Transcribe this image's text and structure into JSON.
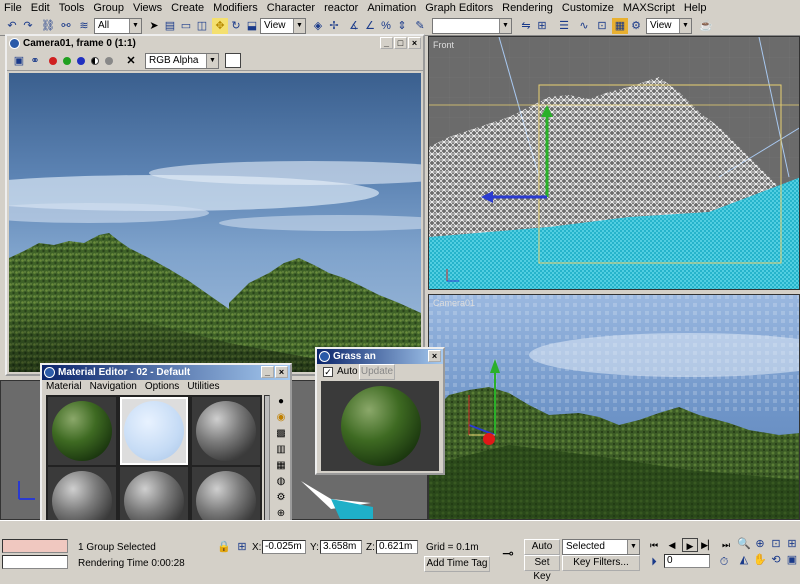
{
  "menu": [
    "File",
    "Edit",
    "Tools",
    "Group",
    "Views",
    "Create",
    "Modifiers",
    "Character",
    "reactor",
    "Animation",
    "Graph Editors",
    "Rendering",
    "Customize",
    "MAXScript",
    "Help"
  ],
  "toolbar": {
    "selection_filter": "All",
    "ref_coord_1": "View",
    "ref_coord_2": "View"
  },
  "render_window": {
    "title": "Camera01, frame 0 (1:1)",
    "channel": "RGB Alpha"
  },
  "front_viewport": {
    "label": "Front"
  },
  "persp_viewport": {
    "label": "Camera01"
  },
  "material_editor": {
    "title": "Material Editor - 02 - Default",
    "menu": [
      "Material",
      "Navigation",
      "Options",
      "Utilities"
    ]
  },
  "grass_window": {
    "title": "Grass an",
    "auto_label": "Auto",
    "update_label": "Update"
  },
  "status": {
    "selection": "1 Group Selected",
    "render_time": "Rendering Time  0:00:28",
    "x_label": "X:",
    "x_value": "-0.025m",
    "y_label": "Y:",
    "y_value": "3.658m",
    "z_label": "Z:",
    "z_value": "0.621m",
    "grid": "Grid = 0.1m",
    "add_time_tag": "Add Time Tag",
    "auto_key": "Auto Key",
    "set_key": "Set Key",
    "key_mode": "Selected",
    "key_filters": "Key Filters...",
    "frame": "0"
  },
  "colors": {
    "ui_gray": "#d4d0c8",
    "title_active": "#0a246a",
    "viewport_gray": "#6b6b6b"
  }
}
